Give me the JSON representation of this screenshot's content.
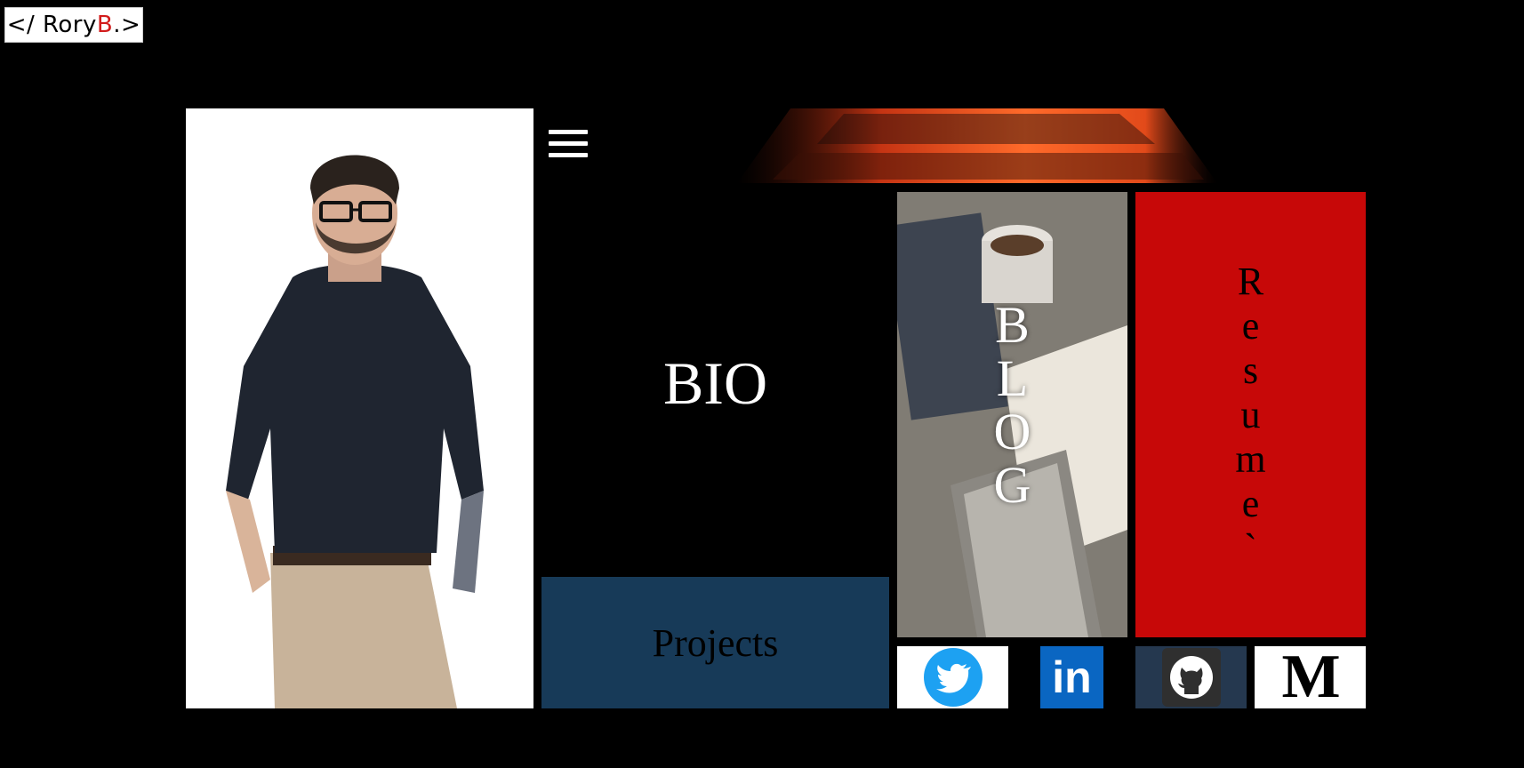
{
  "header": {
    "logo_prefix": "</ Rory ",
    "logo_accent": "B",
    "logo_suffix": ".>"
  },
  "colors": {
    "accent_red": "#c70808",
    "projects_blue": "#173a58",
    "linkedin_blue": "#0a66c2",
    "twitter_blue": "#1da1f2",
    "github_bg": "#25384f"
  },
  "tiles": {
    "bio": "BIO",
    "projects": "Projects",
    "blog_letters": [
      "B",
      "L",
      "O",
      "G"
    ],
    "resume_letters": [
      "R",
      "e",
      "s",
      "u",
      "m",
      "e",
      "`"
    ]
  },
  "social": [
    {
      "name": "twitter",
      "icon": "twitter-icon"
    },
    {
      "name": "linkedin",
      "icon": "linkedin-icon",
      "label": "in"
    },
    {
      "name": "github",
      "icon": "github-icon"
    },
    {
      "name": "medium",
      "icon": "medium-icon",
      "label": "M"
    }
  ]
}
